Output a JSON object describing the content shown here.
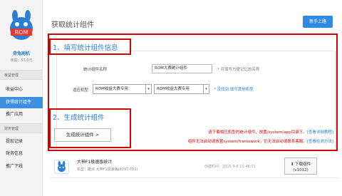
{
  "sidebar": {
    "logo_text": "ROM",
    "brand": "奇兔刷机",
    "income": "收益：53.0元",
    "sections": [
      {
        "title": "收益管理",
        "items": [
          "收益中心",
          "获得统计组件",
          "推广应用"
        ]
      },
      {
        "title": "财务管理",
        "items": [
          "提现记录",
          "财务信息",
          "推广下线"
        ]
      }
    ]
  },
  "main": {
    "page_title": "获取统计组件",
    "top_button": "新手上路",
    "step1": {
      "title": "1、填写统计组件信息",
      "name_label": "统计组件名称",
      "name_value": "ROM大赛统计组件",
      "name_hint": "* 可填写方便记忆的名称",
      "model_label": "适应机型",
      "select1": "ROM收益大赛专用",
      "select2": "ROM收益大赛专用",
      "add_link": "* 没找到,填写其他机型"
    },
    "step2": {
      "title": "2、生成统计组件",
      "button": "生成统计组件 >",
      "note1": "请下载相应机型的统计组件，放置/system/app目录下。",
      "note1_link": "[查看详细教程]",
      "note2": "组件无法启动请放置system/framework，仍无法启动请联系客服。",
      "note2_link": "[查看检测方法]"
    },
    "item": {
      "name": "大神F1极速版统计",
      "meta": "机型：酷派 大神F1极速版(8297-T01)",
      "time": "创建时间：2015-9-8 11:48:01",
      "download": "下载组件",
      "version": "(v1012)"
    }
  },
  "colors": {
    "accent": "#2f8ae6",
    "highlight": "#d40000",
    "active": "#3d8fe0"
  }
}
